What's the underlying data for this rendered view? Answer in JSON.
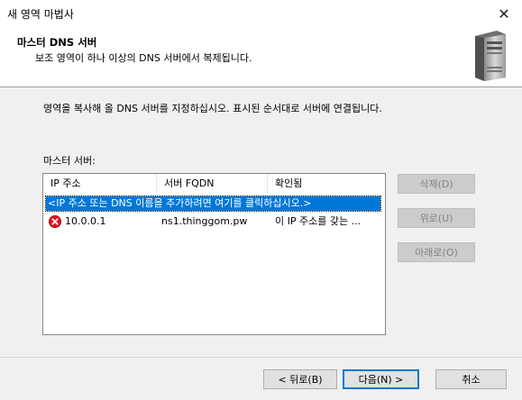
{
  "window": {
    "title": "새 영역 마법사"
  },
  "header": {
    "title": "마스터 DNS 서버",
    "subtitle": "보조 영역이 하나 이상의 DNS 서버에서 복제됩니다."
  },
  "instruction": "영역을 복사해 올 DNS 서버를 지정하십시오. 표시된 순서대로 서버에 연결됩니다.",
  "masters": {
    "label": "마스터 서버:",
    "columns": [
      "IP 주소",
      "서버 FQDN",
      "확인됨"
    ],
    "add_prompt": "<IP 주소 또는 DNS 이름을 추가하려면 여기를 클릭하십시오.>",
    "rows": [
      {
        "ip": "10.0.0.1",
        "fqdn": "ns1.thinggom.pw",
        "validated": "이 IP 주소를 갖는 ...",
        "status_icon": "error-icon"
      }
    ]
  },
  "side_buttons": {
    "delete": "삭제(D)",
    "up": "위로(U)",
    "down": "아래로(O)"
  },
  "footer": {
    "back": "< 뒤로(B)",
    "next": "다음(N) >",
    "cancel": "취소"
  },
  "colors": {
    "selection": "#0078d7",
    "error": "#e81123"
  }
}
